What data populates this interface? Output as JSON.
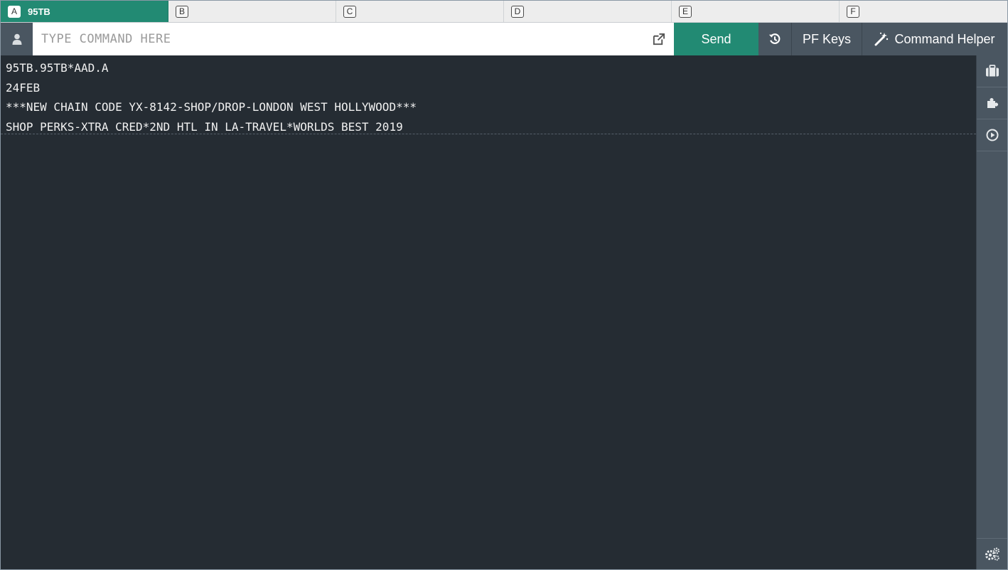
{
  "tabs": [
    {
      "letter": "A",
      "label": "95TB",
      "active": true
    },
    {
      "letter": "B",
      "label": ""
    },
    {
      "letter": "C",
      "label": ""
    },
    {
      "letter": "D",
      "label": ""
    },
    {
      "letter": "E",
      "label": ""
    },
    {
      "letter": "F",
      "label": ""
    }
  ],
  "command": {
    "placeholder": "TYPE COMMAND HERE",
    "value": "",
    "send_label": "Send",
    "pf_keys_label": "PF Keys",
    "helper_label": "Command Helper"
  },
  "terminal": {
    "lines": [
      "95TB.95TB*AAD.A",
      "24FEB",
      "***NEW CHAIN CODE YX-8142-SHOP/DROP-LONDON WEST HOLLYWOOD***",
      "SHOP PERKS-XTRA CRED*2ND HTL IN LA-TRAVEL*WORLDS BEST 2019"
    ]
  },
  "icons": {
    "user": "user-icon",
    "popout": "external-link-icon",
    "history": "history-icon",
    "helper": "magic-wand-icon",
    "sidebar": [
      "briefcase-icon",
      "puzzle-icon",
      "play-circle-icon"
    ],
    "settings": "gears-icon"
  },
  "colors": {
    "accent": "#228a73",
    "toolbar": "#4a5661",
    "terminal_bg": "#252c33",
    "terminal_text": "#f1f1f1"
  }
}
